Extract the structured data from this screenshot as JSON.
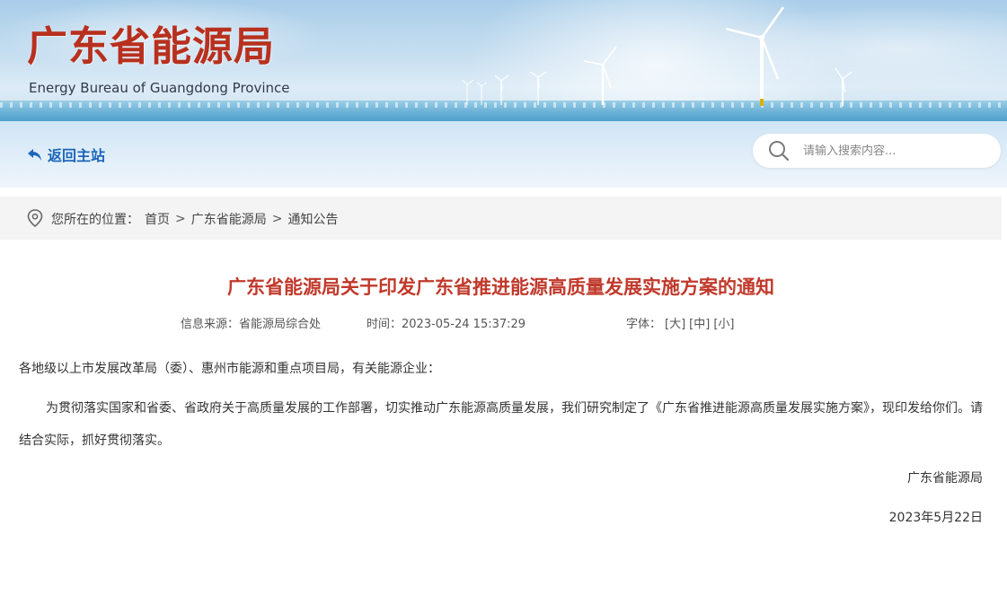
{
  "header": {
    "site_title_cn": "广东省能源局",
    "site_title_en": "Energy Bureau of Guangdong Province"
  },
  "nav": {
    "back_label": "返回主站",
    "search_placeholder": "请输入搜索内容..."
  },
  "breadcrumb": {
    "prefix": "您所在的位置：",
    "items": [
      "首页",
      "广东省能源局",
      "通知公告"
    ],
    "separator": ">"
  },
  "article": {
    "title": "广东省能源局关于印发广东省推进能源高质量发展实施方案的通知",
    "source": "信息来源：省能源局综合处",
    "time": "时间：2023-05-24 15:37:29",
    "font_label": "字体：",
    "font_sizes": [
      "[大]",
      "[中]",
      "[小]"
    ],
    "salutation": "各地级以上市发展改革局（委）、惠州市能源和重点项目局，有关能源企业：",
    "body": "为贯彻落实国家和省委、省政府关于高质量发展的工作部署，切实推动广东能源高质量发展，我们研究制定了《广东省推进能源高质量发展实施方案》，现印发给你们。请结合实际，抓好贯彻落实。",
    "signature_org": "广东省能源局",
    "signature_date": "2023年5月22日"
  },
  "colors": {
    "title_red": "#c0392b",
    "logo_red": "#b8301e",
    "link_blue": "#1b66b9"
  }
}
